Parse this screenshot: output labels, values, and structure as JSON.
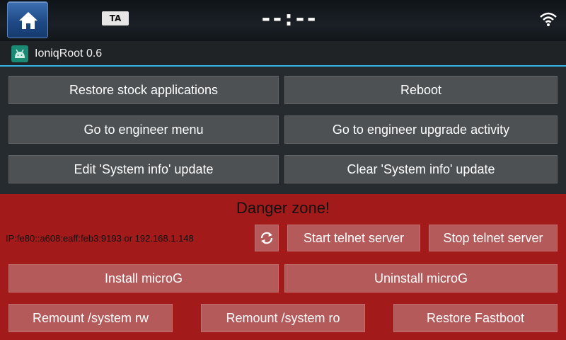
{
  "statusbar": {
    "home_icon": "home-icon",
    "ta_label": "TA",
    "clock": "--:--",
    "wifi_icon": "wifi-icon"
  },
  "app": {
    "icon": "android-icon",
    "title": "IoniqRoot 0.6",
    "accent_color": "#33b5e5"
  },
  "actions": {
    "restore_stock": "Restore stock applications",
    "reboot": "Reboot",
    "engineer_menu": "Go to engineer menu",
    "engineer_upgrade": "Go to engineer upgrade activity",
    "edit_system_info": "Edit 'System info' update",
    "clear_system_info": "Clear 'System info' update"
  },
  "danger": {
    "title": "Danger zone!",
    "background_color": "#a21a1a",
    "ip_text": "IP:fe80::a608:eaff:feb3:9193 or 192.168.1.148",
    "refresh_icon": "refresh-icon",
    "start_telnet": "Start telnet server",
    "stop_telnet": "Stop telnet server",
    "install_microg": "Install microG",
    "uninstall_microg": "Uninstall microG",
    "remount_rw": "Remount /system rw",
    "remount_ro": "Remount /system ro",
    "restore_fastboot": "Restore Fastboot"
  }
}
